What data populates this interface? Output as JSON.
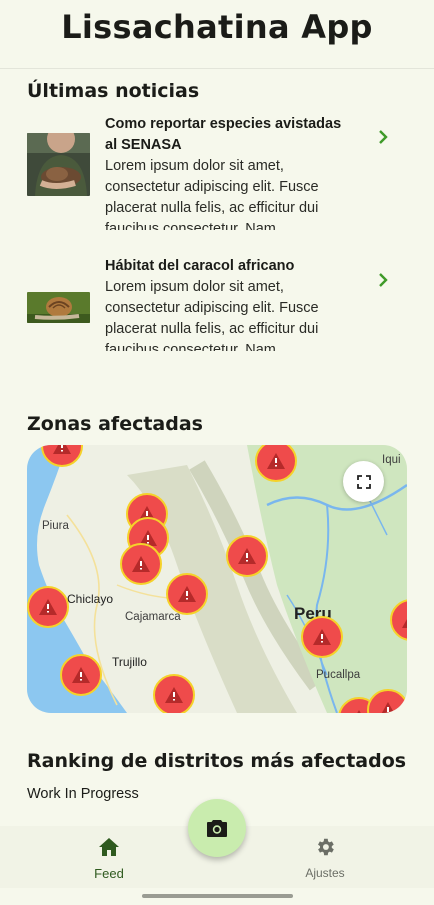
{
  "app": {
    "title": "Lissachatina App"
  },
  "news": {
    "section_title": "Últimas noticias",
    "items": [
      {
        "title": "Como reportar especies avistadas al SENASA",
        "body": "Lorem ipsum dolor sit amet, consectetur adipiscing elit. Fusce placerat nulla felis, ac efficitur dui faucibus consectetur. Nam",
        "thumb_icon": "person-holding-snail-photo"
      },
      {
        "title": "Hábitat del caracol africano",
        "body": "Lorem ipsum dolor sit amet, consectetur adipiscing elit. Fusce placerat nulla felis, ac efficitur dui faucibus consectetur. Nam",
        "thumb_icon": "snail-photo"
      }
    ],
    "chevron_icon": "chevron-right-icon",
    "accent_color": "#3f9a29"
  },
  "map": {
    "section_title": "Zonas afectadas",
    "labels": {
      "piura": "Piura",
      "chiclayo": "Chiclayo",
      "cajamarca": "Cajamarca",
      "trujillo": "Trujillo",
      "peru": "Peru",
      "pucallpa": "Pucallpa",
      "iquitos": "Iqui"
    },
    "marker_icon": "warning-triangle-icon",
    "marker_color": "#ef4b4b",
    "marker_border": "#f5d22a",
    "fullscreen_icon": "fullscreen-icon"
  },
  "ranking": {
    "section_title": "Ranking de distritos más afectados",
    "status_text": "Work In Progress"
  },
  "nav": {
    "items": [
      {
        "label": "Feed",
        "icon": "home-icon",
        "active": true
      },
      {
        "label": "Ajustes",
        "icon": "gear-icon",
        "active": false
      }
    ],
    "fab_icon": "camera-icon",
    "active_color": "#2f5a1f",
    "inactive_color": "#6b6e66"
  }
}
